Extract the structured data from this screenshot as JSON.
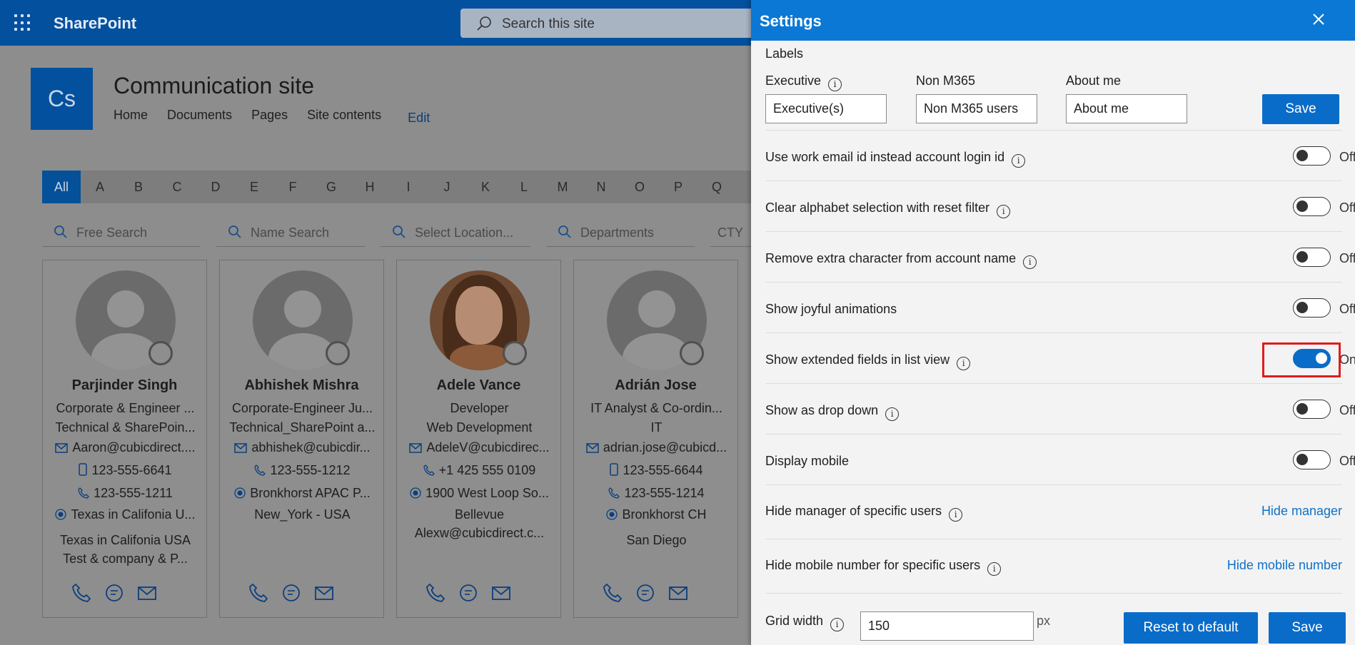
{
  "suitebar": {
    "brand": "SharePoint",
    "search_placeholder": "Search this site"
  },
  "site": {
    "logo_text": "Cs",
    "title": "Communication site",
    "nav": [
      "Home",
      "Documents",
      "Pages",
      "Site contents"
    ],
    "edit_label": "Edit"
  },
  "alphabet": [
    "All",
    "A",
    "B",
    "C",
    "D",
    "E",
    "F",
    "G",
    "H",
    "I",
    "J",
    "K",
    "L",
    "M",
    "N",
    "O",
    "P",
    "Q"
  ],
  "filters": [
    "Free Search",
    "Name Search",
    "Select Location...",
    "Departments",
    "CTY"
  ],
  "cards": [
    {
      "name": "Parjinder Singh",
      "line1": "Corporate & Engineer ...",
      "line2": "Technical & SharePoin...",
      "email": "Aaron@cubicdirect....",
      "mobile": "123-555-6641",
      "phone": "123-555-1211",
      "location": "Texas in Califonia U...",
      "extra1": "Texas in Califonia USA",
      "extra2": "Test & company & P..."
    },
    {
      "name": "Abhishek Mishra",
      "line1": "Corporate-Engineer Ju...",
      "line2": "Technical_SharePoint a...",
      "email": "abhishek@cubicdir...",
      "phone": "123-555-1212",
      "location": "Bronkhorst APAC P...",
      "extra1": "New_York - USA"
    },
    {
      "name": "Adele Vance",
      "line1": "Developer",
      "line2": "Web Development",
      "email": "AdeleV@cubicdirec...",
      "phone": "+1 425 555 0109",
      "location": "1900 West Loop So...",
      "extra1": "Bellevue",
      "extra2": "Alexw@cubicdirect.c..."
    },
    {
      "name": "Adrián Jose",
      "line1": "IT Analyst & Co-ordin...",
      "line2": "IT",
      "email": "adrian.jose@cubicd...",
      "mobile": "123-555-6644",
      "phone": "123-555-1214",
      "location": "Bronkhorst CH",
      "extra1": "San Diego"
    }
  ],
  "panel": {
    "title": "Settings",
    "labels_heading": "Labels",
    "label_fields": [
      {
        "label": "Executive",
        "value": "Executive(s)"
      },
      {
        "label": "Non M365",
        "value": "Non M365 users"
      },
      {
        "label": "About me",
        "value": "About me"
      }
    ],
    "save_label": "Save",
    "toggles": [
      {
        "label": "Use work email id instead account login id",
        "state": "Off"
      },
      {
        "label": "Clear alphabet selection with reset filter",
        "state": "Off"
      },
      {
        "label": "Remove extra character from account name",
        "state": "Off"
      },
      {
        "label": "Show joyful animations",
        "state": "Off"
      },
      {
        "label": "Show extended fields in list view",
        "state": "On"
      },
      {
        "label": "Show as drop down",
        "state": "Off"
      },
      {
        "label": "Display mobile",
        "state": "Off"
      }
    ],
    "hide_manager": {
      "label": "Hide manager of specific users",
      "link": "Hide manager"
    },
    "hide_mobile": {
      "label": "Hide mobile number for specific users",
      "link": "Hide mobile number"
    },
    "grid_width": {
      "label": "Grid width",
      "value": "150",
      "unit": "px"
    },
    "reset_label": "Reset to default",
    "save2_label": "Save"
  },
  "colors": {
    "accent": "#0a78d4",
    "suitebar": "#03509f",
    "highlight": "#e11b1b"
  }
}
